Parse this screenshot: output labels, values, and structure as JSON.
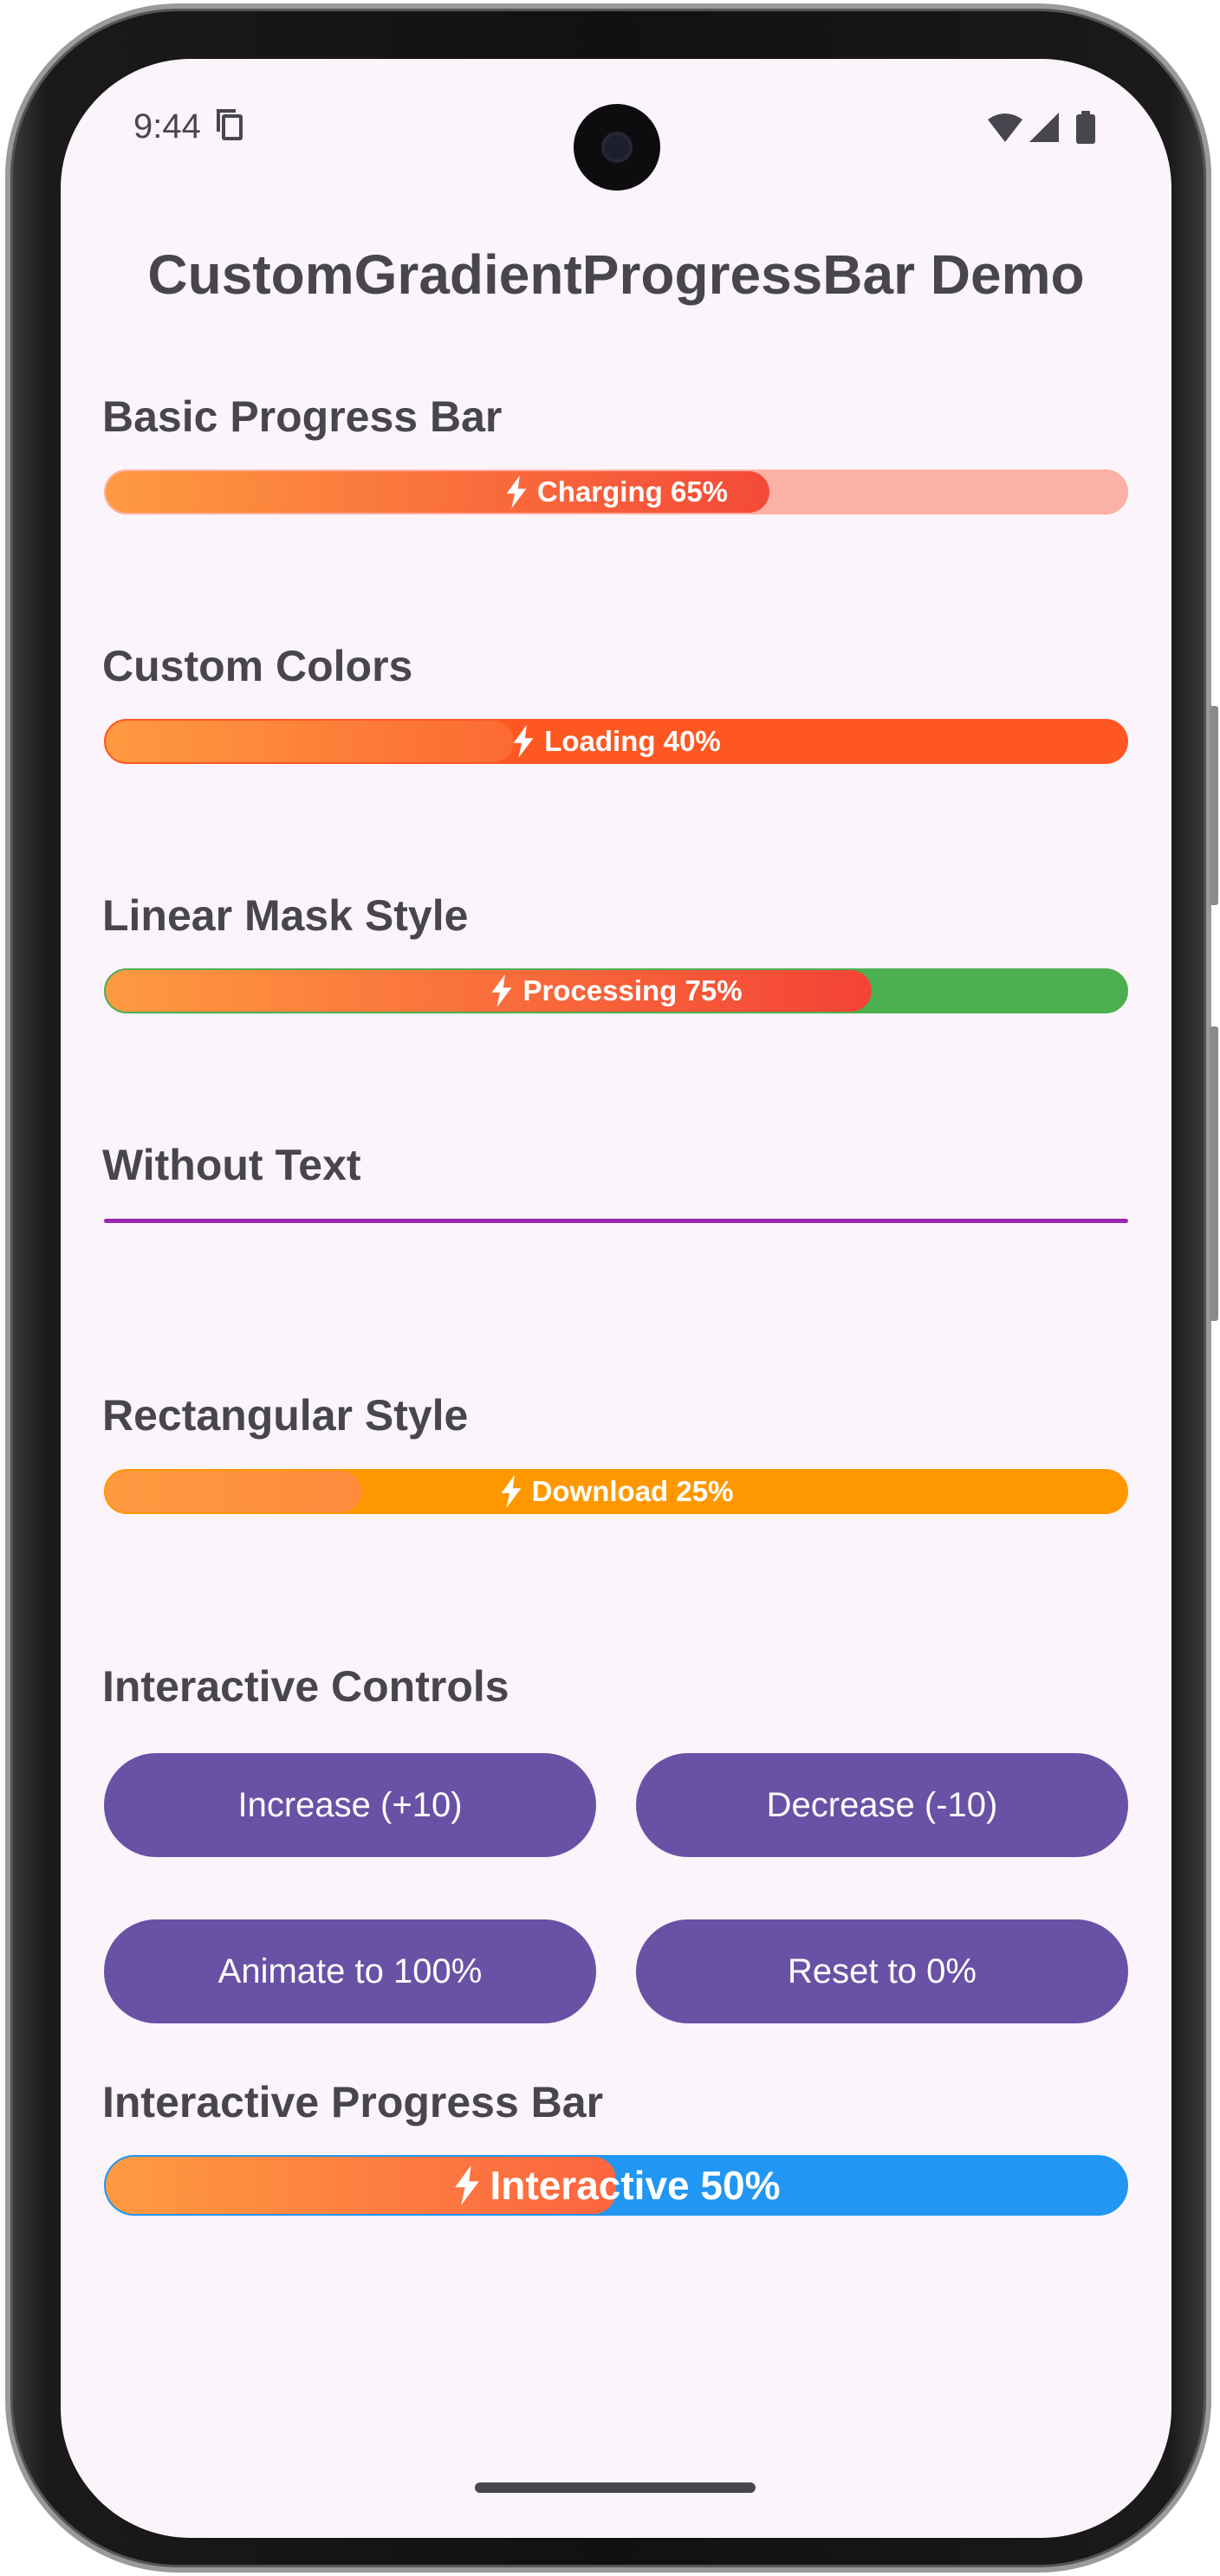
{
  "status_bar": {
    "time": "9:44"
  },
  "page": {
    "title": "CustomGradientProgressBar Demo"
  },
  "sections": {
    "basic": {
      "label": "Basic Progress Bar",
      "bar_text": "Charging 65%",
      "progress": 0.65,
      "track_color": "#fcb1a6",
      "gradient": [
        "#ff9a40",
        "#f44a38"
      ]
    },
    "custom_colors": {
      "label": "Custom Colors",
      "bar_text": "Loading 40%",
      "progress": 0.4,
      "track_color": "#ff5722",
      "gradient": [
        "#ff9a40",
        "#fc6a32"
      ]
    },
    "linear_mask": {
      "label": "Linear Mask Style",
      "bar_text": "Processing 75%",
      "progress": 0.75,
      "track_color": "#4caf50",
      "gradient": [
        "#ff9a40",
        "#f44336"
      ]
    },
    "without_text": {
      "label": "Without Text",
      "line_color": "#9c27b0"
    },
    "rectangular": {
      "label": "Rectangular Style",
      "bar_text": "Download 25%",
      "progress": 0.25,
      "track_color": "#ff9800",
      "gradient": [
        "#ff9a40",
        "#ff8a3c"
      ]
    },
    "interactive_controls": {
      "label": "Interactive Controls",
      "buttons": {
        "increase": "Increase (+10)",
        "decrease": "Decrease (-10)",
        "animate": "Animate to 100%",
        "reset": "Reset to 0%"
      }
    },
    "interactive_bar": {
      "label": "Interactive Progress Bar",
      "bar_text": "Interactive 50%",
      "progress": 0.5,
      "track_color": "#2196f3",
      "gradient": [
        "#ff9a40",
        "#fc6540"
      ]
    }
  },
  "colors": {
    "screen_bg": "#fcf4fb",
    "text": "#47464f",
    "button": "#6951a5",
    "accent_purple": "#9c27b0"
  },
  "icons": [
    "bolt-icon",
    "wifi-icon",
    "signal-icon",
    "battery-icon",
    "screenshot-icon"
  ]
}
